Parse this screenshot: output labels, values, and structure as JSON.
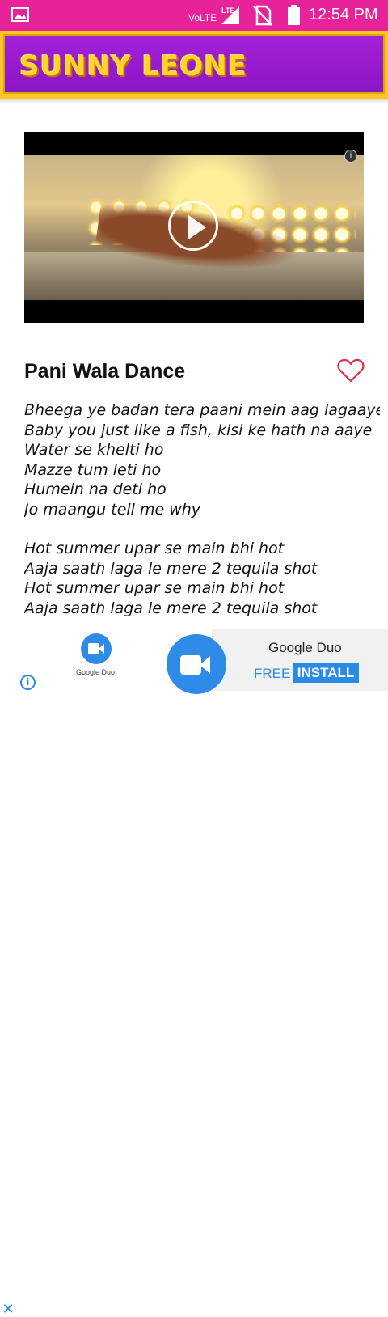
{
  "status_bar": {
    "network_label": "VoLTE",
    "network_type": "LTE",
    "time": "12:54 PM",
    "icons": [
      "gallery-icon",
      "signal-icon",
      "no-sim-icon",
      "battery-icon"
    ]
  },
  "header": {
    "title": "SUNNY LEONE"
  },
  "song": {
    "title": "Pani Wala Dance",
    "favorite_icon": "heart-outline-icon",
    "lyrics": [
      "Bheega ye badan tera paani mein aag lagaaye",
      "Baby you just like a fish, kisi ke hath na aaye",
      "Water se khelti ho",
      "Mazze tum leti ho",
      "Humein na deti ho",
      "Jo maangu tell me why",
      "",
      "Hot summer upar se main bhi hot",
      "Aaja saath laga le mere 2 tequila shot",
      "Hot summer upar se main bhi hot",
      "Aaja saath laga le mere 2 tequila shot"
    ]
  },
  "ad": {
    "small_app_label": "Google Duo",
    "app_name": "Google Duo",
    "free_label": "FREE",
    "install_label": "INSTALL",
    "close_symbol": "✕",
    "info_symbol": "i"
  },
  "colors": {
    "status_bar": "#e8239a",
    "header_bg": "#9b1bd2",
    "header_border": "#ffc425",
    "title_text": "#ffd42a",
    "accent": "#e8239a",
    "ad_blue": "#2a8be6"
  }
}
